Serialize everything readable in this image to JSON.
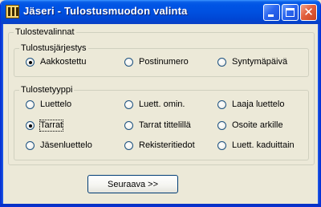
{
  "window": {
    "title": "Jäseri - Tulostusmuodon valinta",
    "controls": {
      "minimize": "minimize",
      "maximize": "maximize",
      "close": "✕"
    }
  },
  "options_group": {
    "label": "Tulostevalinnat"
  },
  "order_group": {
    "label": "Tulostusjärjestys",
    "items": [
      {
        "label": "Aakkostettu",
        "checked": true
      },
      {
        "label": "Postinumero",
        "checked": false
      },
      {
        "label": "Syntymäpäivä",
        "checked": false
      }
    ]
  },
  "type_group": {
    "label": "Tulostetyyppi",
    "items": [
      {
        "label": "Luettelo",
        "checked": false
      },
      {
        "label": "Luett. omin.",
        "checked": false
      },
      {
        "label": "Laaja luettelo",
        "checked": false
      },
      {
        "label": "Tarrat",
        "checked": true,
        "focused": true
      },
      {
        "label": "Tarrat tittelillä",
        "checked": false
      },
      {
        "label": "Osoite arkille",
        "checked": false
      },
      {
        "label": "Jäsenluettelo",
        "checked": false
      },
      {
        "label": "Rekisteritiedot",
        "checked": false
      },
      {
        "label": "Luett. kaduittain",
        "checked": false
      }
    ]
  },
  "next_button": {
    "label": "Seuraava >>"
  },
  "colors": {
    "titlebar": "#0055e5",
    "face": "#ece9d8",
    "frame": "#0831d9"
  }
}
